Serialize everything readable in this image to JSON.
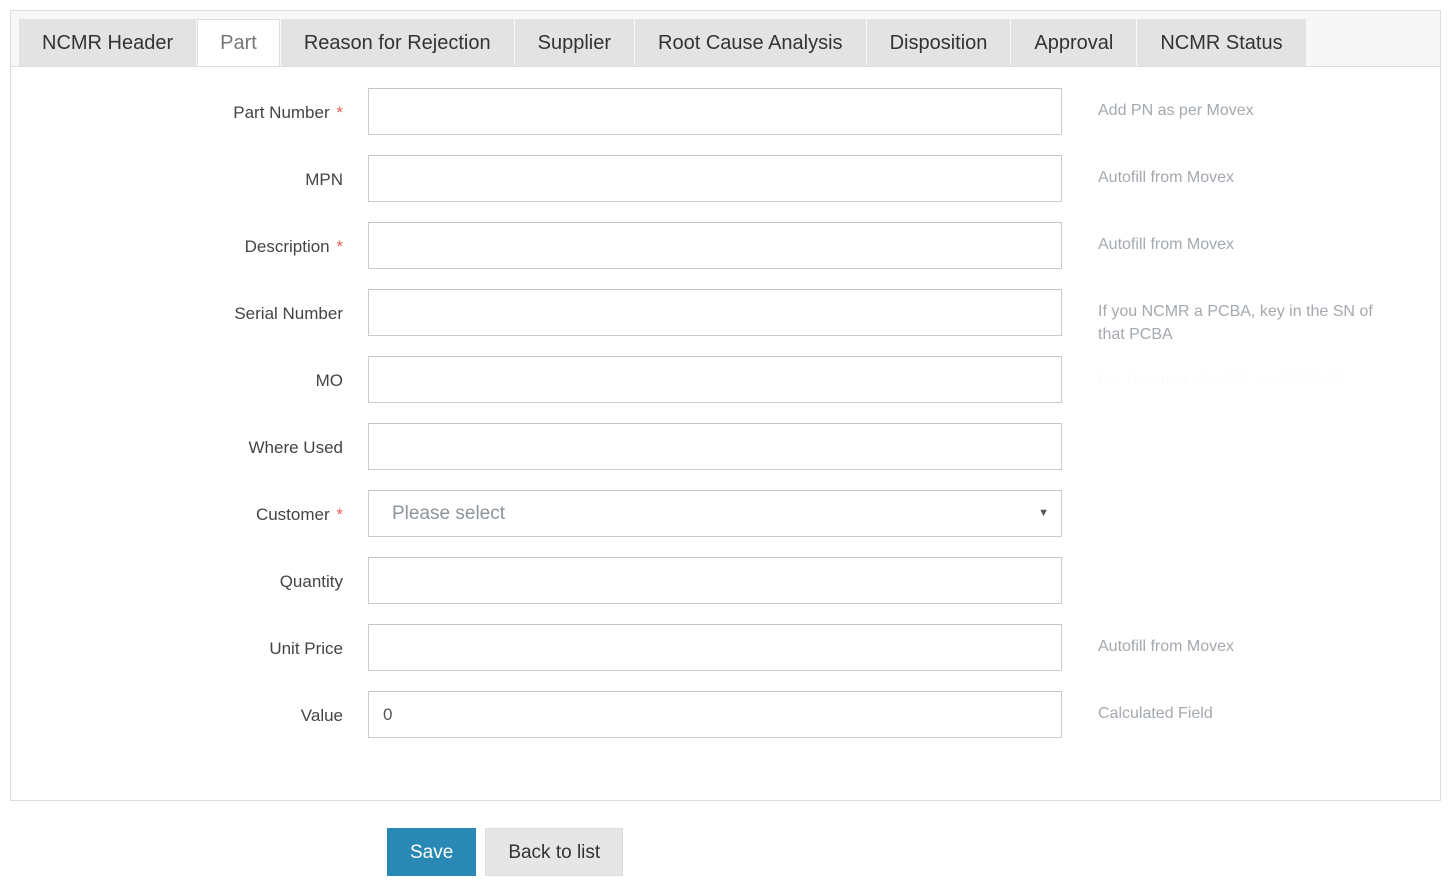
{
  "tabs": [
    {
      "label": "NCMR Header",
      "active": false
    },
    {
      "label": "Part",
      "active": true
    },
    {
      "label": "Reason for Rejection",
      "active": false
    },
    {
      "label": "Supplier",
      "active": false
    },
    {
      "label": "Root Cause Analysis",
      "active": false
    },
    {
      "label": "Disposition",
      "active": false
    },
    {
      "label": "Approval",
      "active": false
    },
    {
      "label": "NCMR Status",
      "active": false
    }
  ],
  "form": {
    "fields": [
      {
        "label": "Part Number",
        "required": true,
        "required_marker": "*",
        "type": "text",
        "value": "",
        "placeholder": "",
        "help": "Add PN as per Movex",
        "help_ghost": false
      },
      {
        "label": "MPN",
        "required": false,
        "required_marker": "",
        "type": "text",
        "value": "",
        "placeholder": "",
        "help": "Autofill from Movex",
        "help_ghost": false
      },
      {
        "label": "Description",
        "required": true,
        "required_marker": "*",
        "type": "text",
        "value": "",
        "placeholder": "",
        "help": "Autofill from Movex",
        "help_ghost": false
      },
      {
        "label": "Serial Number",
        "required": false,
        "required_marker": "",
        "type": "text",
        "value": "",
        "placeholder": "",
        "help": "If you NCMR a PCBA, key in the SN of that PCBA",
        "help_ghost": false
      },
      {
        "label": "MO",
        "required": false,
        "required_marker": "",
        "type": "text",
        "value": "",
        "placeholder": "",
        "help": "For Reamed add MO as 000XXXX",
        "help_ghost": true
      },
      {
        "label": "Where Used",
        "required": false,
        "required_marker": "",
        "type": "text",
        "value": "",
        "placeholder": "",
        "help": "",
        "help_ghost": false
      },
      {
        "label": "Customer",
        "required": true,
        "required_marker": "*",
        "type": "select",
        "value": "Please select",
        "placeholder": "",
        "help": "",
        "help_ghost": false
      },
      {
        "label": "Quantity",
        "required": false,
        "required_marker": "",
        "type": "text",
        "value": "",
        "placeholder": "",
        "help": "",
        "help_ghost": false
      },
      {
        "label": "Unit Price",
        "required": false,
        "required_marker": "",
        "type": "text",
        "value": "",
        "placeholder": "",
        "help": "Autofill from Movex",
        "help_ghost": false
      },
      {
        "label": "Value",
        "required": false,
        "required_marker": "",
        "type": "text",
        "value": "0",
        "placeholder": "",
        "help": "Calculated Field",
        "help_ghost": false
      }
    ],
    "select_caret_icon": "chevron-down-icon"
  },
  "footer": {
    "save_label": "Save",
    "back_label": "Back to list"
  },
  "colors": {
    "primary": "#2a88b5",
    "required": "#e8615c",
    "tab_inactive_bg": "#e3e3e3",
    "tab_active_bg": "#ffffff",
    "help_text": "#a3a9ae",
    "border": "#dddddd"
  }
}
